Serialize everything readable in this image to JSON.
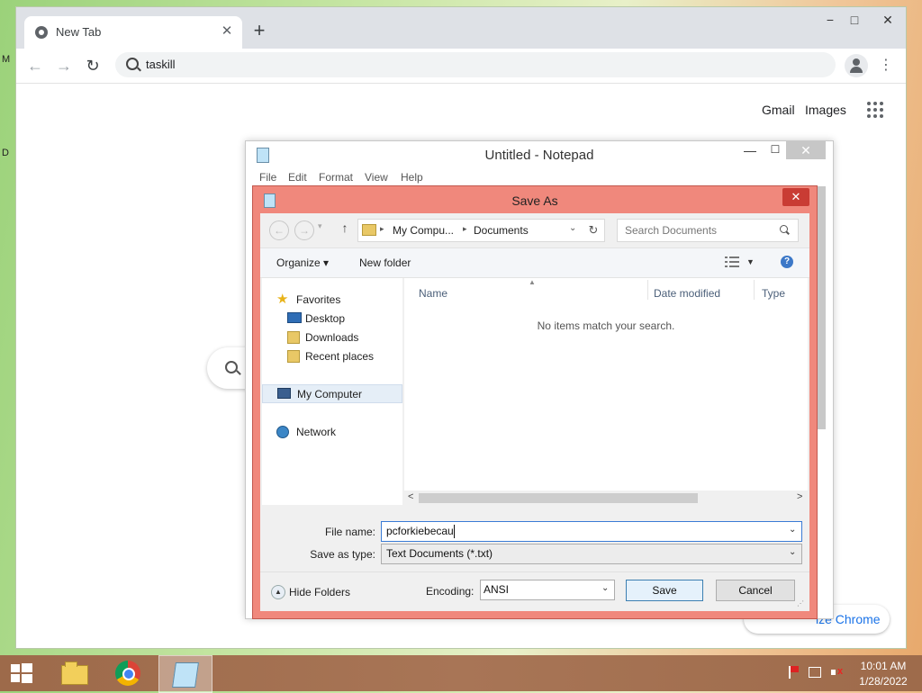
{
  "desktop": {
    "edge_labels": [
      "M",
      "D"
    ]
  },
  "chrome": {
    "tab_title": "New Tab",
    "tab_close": "✕",
    "new_tab": "+",
    "controls": {
      "minimize": "−",
      "maximize": "□",
      "close": "✕"
    },
    "nav": {
      "back": "←",
      "forward": "→",
      "reload": "↻"
    },
    "omnibox_value": "taskill",
    "menu": "⋮",
    "links": {
      "gmail": "Gmail",
      "images": "Images"
    },
    "customize_chrome": "ize Chrome"
  },
  "notepad": {
    "title": "Untitled - Notepad",
    "controls": {
      "minimize": "—",
      "maximize": "☐",
      "close": "✕"
    },
    "menu": [
      "File",
      "Edit",
      "Format",
      "View",
      "Help"
    ]
  },
  "save_as": {
    "title": "Save As",
    "close": "✕",
    "address": {
      "segments": [
        "My Compu...",
        "Documents"
      ],
      "separators": [
        "▸",
        "▸"
      ],
      "dropdown": "⌄",
      "refresh": "↻"
    },
    "nav_buttons": {
      "back": "←",
      "forward": "→",
      "recent": "▾",
      "up": "↑"
    },
    "search_placeholder": "Search Documents",
    "commands": {
      "organize": "Organize ▾",
      "new_folder": "New folder",
      "views_dropdown": "▼",
      "help": "?"
    },
    "nav_pane": {
      "favorites": "Favorites",
      "favorite_items": [
        "Desktop",
        "Downloads",
        "Recent places"
      ],
      "my_computer": "My Computer",
      "network": "Network"
    },
    "columns": [
      "Name",
      "Date modified",
      "Type"
    ],
    "sort_indicator": "▲",
    "empty_message": "No items match your search.",
    "hscroll": {
      "left": "<",
      "right": ">"
    },
    "file_name_label": "File name:",
    "file_name_value": "pcforkiebecau",
    "save_type_label": "Save as type:",
    "save_type_value": "Text Documents (*.txt)",
    "hide_folders": "Hide Folders",
    "hide_folders_glyph": "▲",
    "encoding_label": "Encoding:",
    "encoding_value": "ANSI",
    "dropdown_glyph": "⌄",
    "save_button": "Save",
    "cancel_button": "Cancel"
  },
  "taskbar": {
    "time": "10:01 AM",
    "date": "1/28/2022"
  },
  "icons": {
    "start": "windows-logo",
    "pinned": [
      "file-explorer",
      "chrome",
      "notepad"
    ],
    "tray": [
      "action-center-flag",
      "network",
      "volume-muted"
    ]
  }
}
